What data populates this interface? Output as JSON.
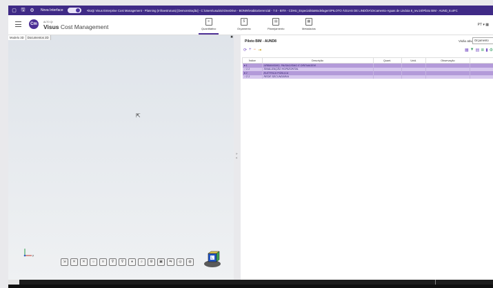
{
  "titlebar": {
    "new_interface_label": "Nova Interface",
    "window_title": "AltoQi Visus Enterprise Cost Management - Planning (Infraestrutura) [Demonstração] - C:\\Users\\usuário\\OneDrive - BONIN\\HabitaGerencial - 7.0 - BITA - CDHU_EspecialistaModelagem\\PILOTO ÁGUAS DE LINDÓIA\\Orcamento-Aguas de Lindoia 8_rev.24\\Piloto BIM - AUND_8.xIFC"
  },
  "header": {
    "logo_small": "ALTO QI",
    "logo_brand": "Visus",
    "logo_product": "Cost Management",
    "tabs": [
      {
        "label": "Quantitativo",
        "icon": "quantity-icon"
      },
      {
        "label": "Orçamento",
        "icon": "budget-icon"
      },
      {
        "label": "Planejamento",
        "icon": "planning-icon"
      },
      {
        "label": "Metadados",
        "icon": "metadata-icon"
      }
    ],
    "language": "PT"
  },
  "left_panel": {
    "tabs": [
      "Modelo 3D",
      "Documentos 2D"
    ],
    "splitter_top": "»",
    "splitter_bottom": "«",
    "toolbar_icons": [
      "fit-icon",
      "cross-icon",
      "cross-icon",
      "light-icon",
      "layers-icon",
      "filter-icon",
      "filter-icon",
      "lamp-icon",
      "zoom-icon",
      "settings-icon",
      "select-icon",
      "measure-icon",
      "camera-icon",
      "globe-icon"
    ],
    "axis_label": "y"
  },
  "right_panel": {
    "title": "Piloto BIM - AUND8",
    "view_label": "Visão ativa",
    "view_value": "Orçamento",
    "columns": [
      "Índice",
      "Descrição",
      "Quant.",
      "Unid.",
      "Observação"
    ],
    "rows": [
      {
        "index": "1",
        "desc": "URBANISMO, PAISAGISMO E DRENAGEM",
        "level": 1,
        "expanded": true
      },
      {
        "index": "1.1",
        "desc": "SINALIZAÇÃO HORIZONTAL",
        "level": 2,
        "expanded": false
      },
      {
        "index": "2",
        "desc": "ELÉTRICA PÚBLICA",
        "level": 1,
        "expanded": true
      },
      {
        "index": "2.1",
        "desc": "REDE SECUNDÁRIA",
        "level": 2,
        "expanded": false
      }
    ]
  },
  "colors": {
    "titlebar": "#3f2a86",
    "accent": "#4c2f95",
    "row_level1": "#b39ad9",
    "row_level2": "#d6c7ee"
  }
}
